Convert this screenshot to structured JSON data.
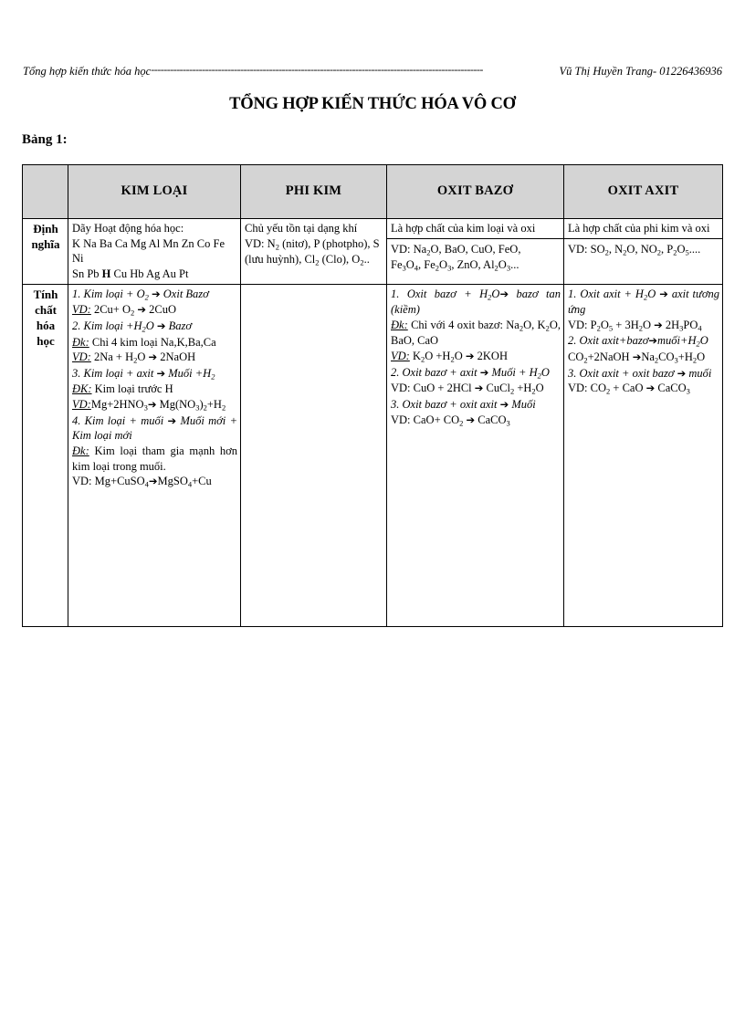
{
  "header": {
    "left_text": "Tổng hợp kiến thức hóa học",
    "dots": "--------------------------------------------------------------------------------------------------------",
    "right_text": "Vũ Thị Huyền Trang- 01226436936"
  },
  "title": "TỔNG HỢP KIẾN THỨC HÓA VÔ CƠ",
  "table_label": "Bảng 1:",
  "table": {
    "columns": [
      {
        "key": "label",
        "header": ""
      },
      {
        "key": "kim_loai",
        "header": "KIM LOẠI"
      },
      {
        "key": "phi_kim",
        "header": "PHI KIM"
      },
      {
        "key": "oxit_bazo",
        "header": "OXIT BAZƠ"
      },
      {
        "key": "oxit_axit",
        "header": "OXIT AXIT"
      }
    ],
    "rows": [
      {
        "label": "Định nghĩa",
        "kim_loai": {
          "lines": [
            "Dãy Hoạt động hóa học:",
            "K Na Ba Ca Mg Al Mn Zn Co Fe Ni",
            "Sn Pb H Cu Hb Ag Au Pt"
          ]
        },
        "phi_kim": {
          "lines": [
            "Chủ yếu tồn tại dạng khí",
            "VD: N2 (nitơ), P (photpho), S",
            "(lưu huỳnh), Cl2 (Clo), O2.."
          ]
        },
        "oxit_bazo": {
          "definition": "Là  hợp chất của kim loại và oxi",
          "examples": [
            "VD: Na2O, BaO, CuO, FeO,",
            "Fe3O4, Fe2O3, ZnO, Al2O3..."
          ]
        },
        "oxit_axit": {
          "definition": "Là hợp chất của phi kim và oxi",
          "examples": [
            "VD: SO2, N2O, NO2, P2O5...."
          ]
        }
      },
      {
        "label": "Tính chất hóa học",
        "kim_loai": {
          "lines": [
            "1. Kim loại + O2 → Oxit Bazơ",
            "VD:  2Cu+ O2 → 2CuO",
            "2. Kim loại +H2O → Bazơ",
            "Đk: Chỉ 4 kim loại Na,K,Ba,Ca",
            "VD: 2Na + H2O → 2NaOH",
            "3. Kim loại + axit → Muối +H2",
            "ĐK: Kim loại trước H",
            "VD:Mg+2HNO3→ Mg(NO3)2+H2",
            "4. Kim loại + muối → Muối mới + Kim loại mới",
            "Đk: Kim loại tham gia mạnh hơn kim loại trong muối.",
            "VD: Mg+CuSO4→MgSO4+Cu"
          ]
        },
        "phi_kim": {
          "lines": []
        },
        "oxit_bazo": {
          "lines": [
            "1. Oxit bazơ + H2O→ bazơ tan (kiềm)",
            "Đk: Chỉ với 4 oxit bazơ: Na2O, K2O, BaO, CaO",
            "VD:  K2O +H2O → 2KOH",
            "2. Oxit bazơ + axit → Muối + H2O",
            "VD: CuO + 2HCl → CuCl2 +H2O",
            "3. Oxit bazơ + oxit axit → Muối",
            "VD: CaO+ CO2 → CaCO3"
          ]
        },
        "oxit_axit": {
          "lines": [
            "1. Oxit  axit  +  H2O  →  axit tương ứng",
            "VD: P2O5 + 3H2O → 2H3PO4",
            "2. Oxit axit+bazơ→muối+H2O",
            "CO2+2NaOH →Na2CO3+H2O",
            "3. Oxit axit + oxit bazơ → muối",
            "VD: CO2 + CaO → CaCO3"
          ]
        }
      }
    ]
  },
  "colors": {
    "header_fill": "#d4d4d4",
    "border": "#000000",
    "text": "#000000",
    "page_bg": "#ffffff"
  }
}
